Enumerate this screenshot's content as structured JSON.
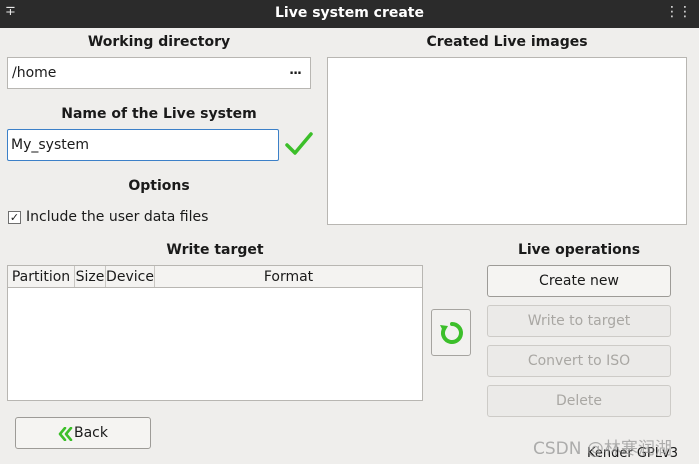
{
  "window": {
    "title": "Live system create"
  },
  "working_directory": {
    "heading": "Working directory",
    "value": "/home",
    "browse_label": "..."
  },
  "created_images": {
    "heading": "Created Live images",
    "items": []
  },
  "live_name": {
    "heading": "Name of the Live system",
    "value": "My_system",
    "valid_icon": "checkmark-icon",
    "valid_color": "#3cbf2a"
  },
  "options": {
    "heading": "Options",
    "include_user_data": {
      "label": "Include the user data files",
      "checked": true,
      "mark": "✓"
    }
  },
  "write_target": {
    "heading": "Write target",
    "columns": [
      "Partition",
      "Size",
      "Device",
      "Format"
    ],
    "rows": []
  },
  "live_operations": {
    "heading": "Live operations",
    "buttons": [
      {
        "label": "Create new",
        "enabled": true
      },
      {
        "label": "Write to target",
        "enabled": false
      },
      {
        "label": "Convert to ISO",
        "enabled": false
      },
      {
        "label": "Delete",
        "enabled": false
      }
    ],
    "refresh_icon": "refresh-icon",
    "accent_color": "#3cbf2a"
  },
  "back_button": {
    "label": "Back",
    "icon": "double-chevron-left-icon"
  },
  "status": {
    "text": "Kender GPLv3"
  },
  "watermark": {
    "text": "CSDN @林寒润湖"
  }
}
